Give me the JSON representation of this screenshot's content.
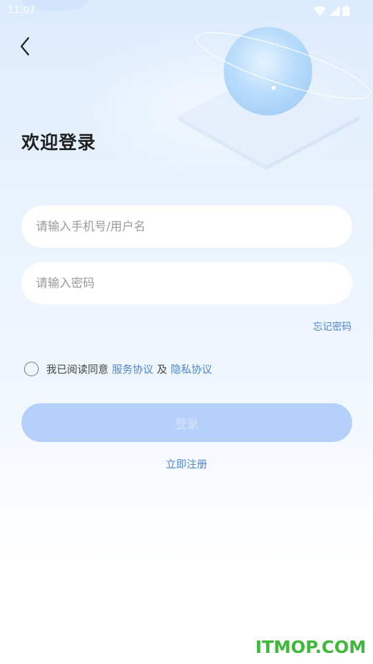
{
  "status_bar": {
    "time": "11:07"
  },
  "header": {
    "title": "欢迎登录"
  },
  "form": {
    "account_placeholder": "请输入手机号/用户名",
    "password_placeholder": "请输入密码",
    "forgot_label": "忘记密码"
  },
  "agreement": {
    "prefix": "我已阅读同意",
    "service_link": "服务协议",
    "joiner": "及",
    "privacy_link": "隐私协议",
    "checked": false
  },
  "login_button": {
    "label": "登录",
    "enabled": false
  },
  "register_link": {
    "label": "立即注册"
  },
  "watermark": {
    "text": "ITMOP.COM"
  },
  "colors": {
    "accent": "#4a86d8",
    "button_disabled": "#b5d0fa",
    "watermark": "#3fb83a"
  }
}
